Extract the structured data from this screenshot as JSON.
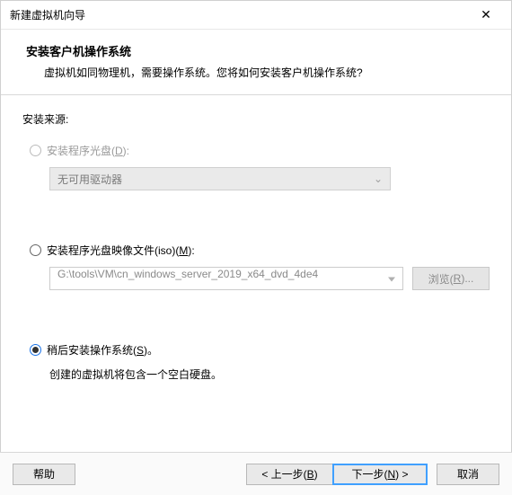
{
  "window": {
    "title": "新建虚拟机向导",
    "close_icon": "✕"
  },
  "header": {
    "heading": "安装客户机操作系统",
    "subheading": "虚拟机如同物理机，需要操作系统。您将如何安装客户机操作系统?"
  },
  "content": {
    "source_label": "安装来源:",
    "opt_disc": {
      "label_pre": "安装程序光盘(",
      "mnemonic": "D",
      "label_post": "):",
      "combo_text": "无可用驱动器"
    },
    "opt_iso": {
      "label_pre": "安装程序光盘映像文件(iso)(",
      "mnemonic": "M",
      "label_post": "):",
      "path": "G:\\tools\\VM\\cn_windows_server_2019_x64_dvd_4de4",
      "browse_pre": "浏览(",
      "browse_mn": "R",
      "browse_post": ")..."
    },
    "opt_later": {
      "label_pre": "稍后安装操作系统(",
      "mnemonic": "S",
      "label_post": ")。",
      "hint": "创建的虚拟机将包含一个空白硬盘。"
    }
  },
  "footer": {
    "help": "帮助",
    "back_pre": "< 上一步(",
    "back_mn": "B",
    "back_post": ")",
    "next_pre": "下一步(",
    "next_mn": "N",
    "next_post": ") >",
    "cancel": "取消"
  }
}
